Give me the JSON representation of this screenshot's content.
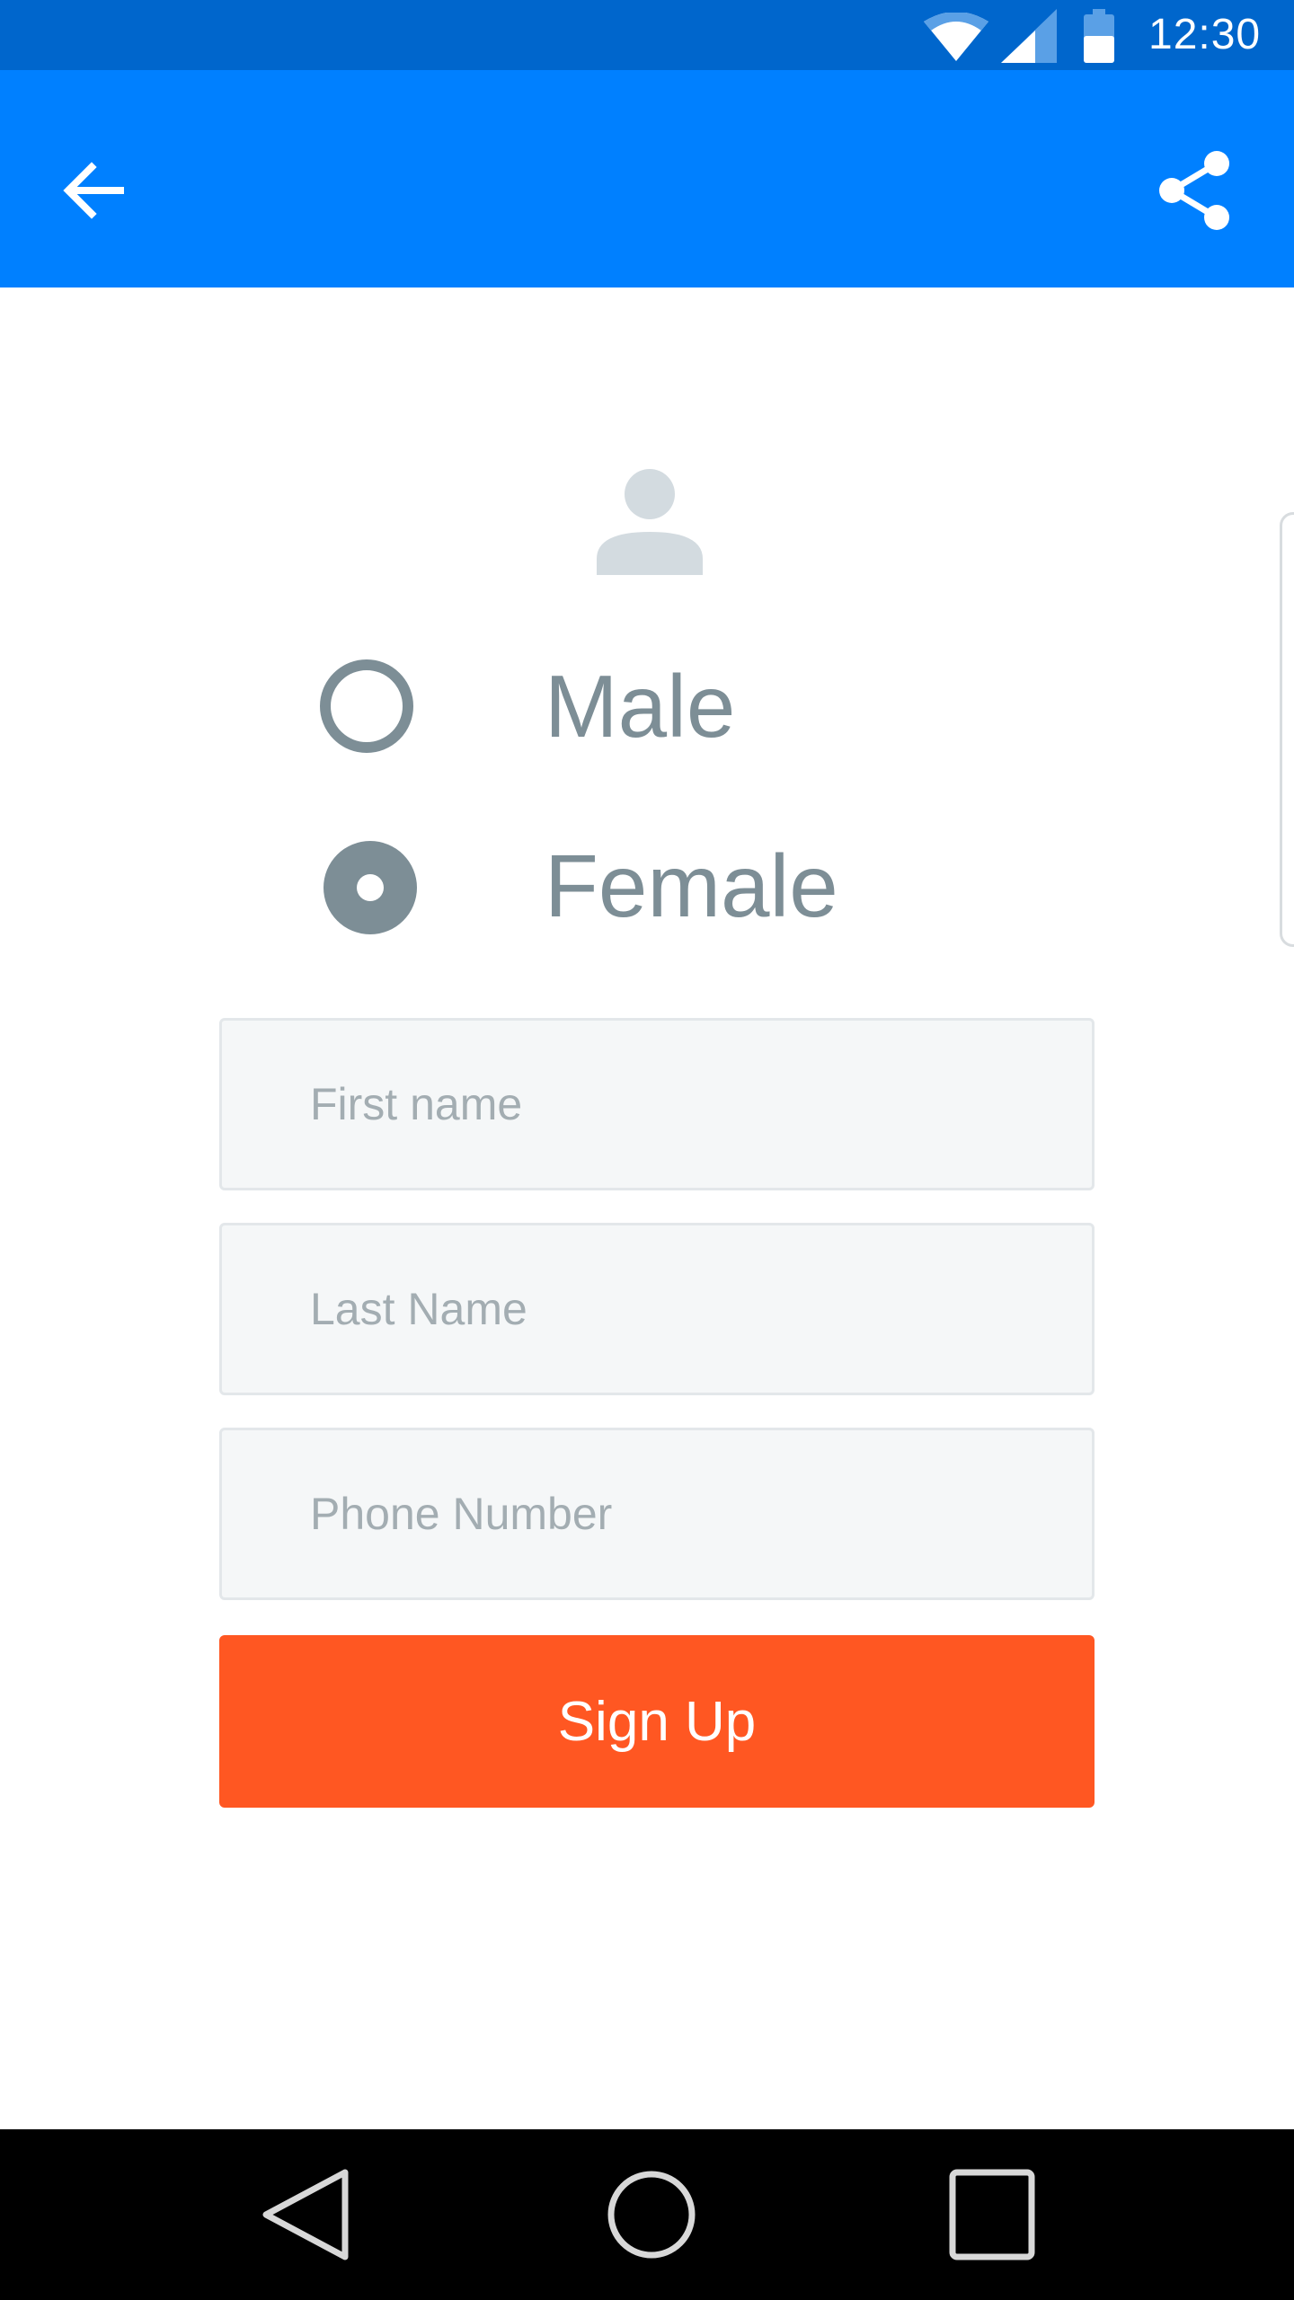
{
  "colors": {
    "status_bar": "#0066CC",
    "app_bar": "#0080FF",
    "primary_text": "#7D8E96",
    "input_bg": "#F5F7F8",
    "input_border": "#E3E7EA",
    "placeholder": "#A3ADB2",
    "signup_button": "#FF5722",
    "nav_bar": "#000000"
  },
  "status_bar": {
    "time": "12:30",
    "icons": [
      "wifi-icon",
      "cell-signal-icon",
      "battery-icon"
    ]
  },
  "app_bar": {
    "icons": [
      "arrow-back-icon",
      "share-icon"
    ]
  },
  "avatar": {
    "icon": "person-icon"
  },
  "gender": {
    "options": [
      {
        "label": "Male",
        "selected": false
      },
      {
        "label": "Female",
        "selected": true
      }
    ]
  },
  "form": {
    "first_name": {
      "placeholder": "First name",
      "value": ""
    },
    "last_name": {
      "placeholder": "Last Name",
      "value": ""
    },
    "phone": {
      "placeholder": "Phone Number",
      "value": ""
    },
    "signup_label": "Sign Up"
  },
  "nav_bar": {
    "icons": [
      "nav-back-icon",
      "nav-home-icon",
      "nav-recents-icon"
    ]
  }
}
